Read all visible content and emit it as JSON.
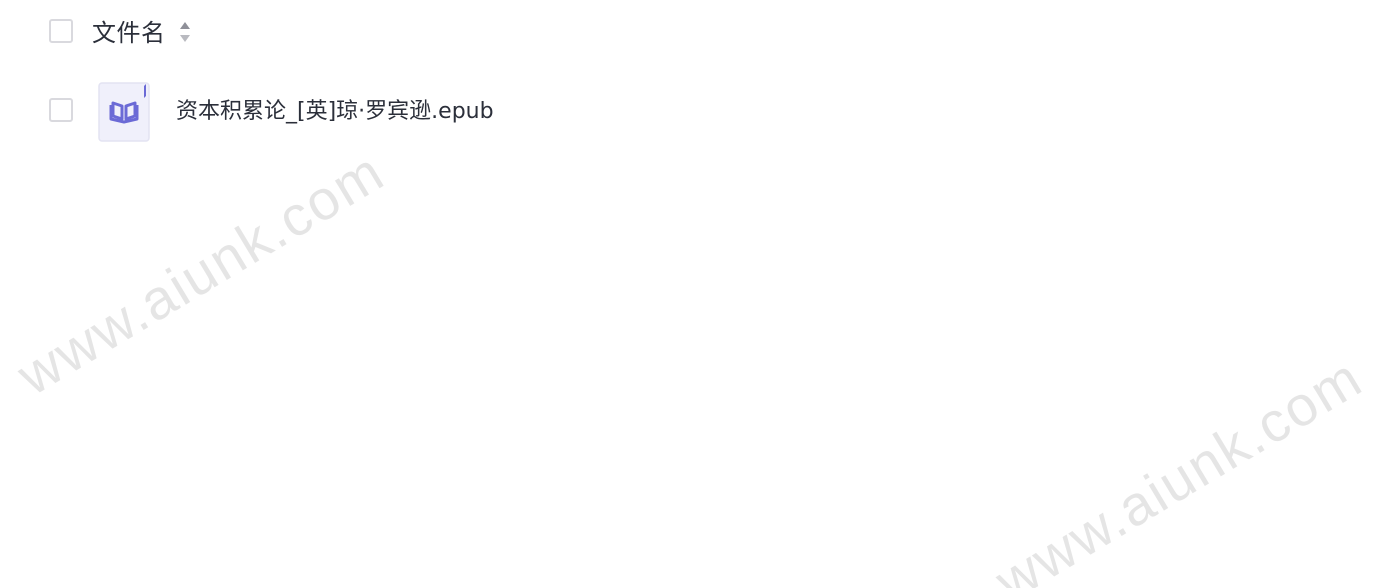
{
  "header": {
    "column_label": "文件名",
    "sort_icon": "sort-updown-icon"
  },
  "files": [
    {
      "name": "资本积累论_[英]琼·罗宾逊.epub",
      "icon": "epub-book-icon"
    }
  ],
  "watermark": {
    "text": "www.aiunk.com"
  },
  "colors": {
    "text": "#2b2f3a",
    "checkbox_border": "#d9d9de",
    "file_icon_bg": "#f0f0fb",
    "file_icon_accent": "#6b6ad6"
  }
}
